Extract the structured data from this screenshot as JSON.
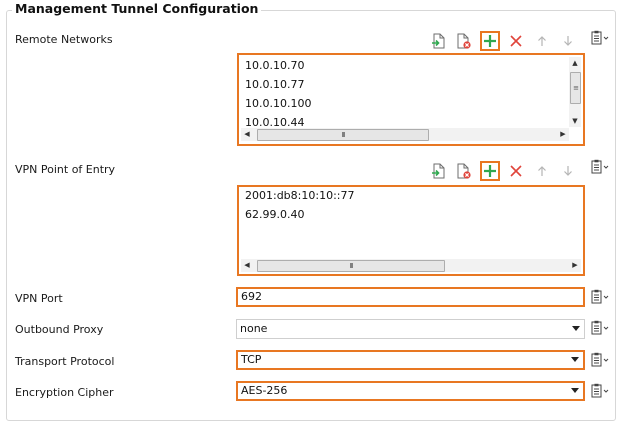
{
  "group_title": "Management Tunnel Configuration",
  "remote_networks": {
    "label": "Remote Networks",
    "items": [
      "10.0.10.70",
      "10.0.10.77",
      "10.0.10.100",
      "10.0.10.44"
    ]
  },
  "vpn_entry": {
    "label": "VPN Point of Entry",
    "items": [
      "2001:db8:10:10::77",
      "62.99.0.40"
    ]
  },
  "vpn_port": {
    "label": "VPN Port",
    "value": "692"
  },
  "outbound_proxy": {
    "label": "Outbound Proxy",
    "value": "none"
  },
  "transport_protocol": {
    "label": "Transport Protocol",
    "value": "TCP"
  },
  "encryption_cipher": {
    "label": "Encryption Cipher",
    "value": "AES-256"
  },
  "colors": {
    "highlight": "#e87722",
    "add_green": "#2fa84f",
    "delete_red": "#e0443b"
  },
  "icons": [
    "import-icon",
    "remove-icon",
    "add-icon",
    "delete-icon",
    "move-up-icon",
    "move-down-icon",
    "clipboard-menu-icon"
  ]
}
